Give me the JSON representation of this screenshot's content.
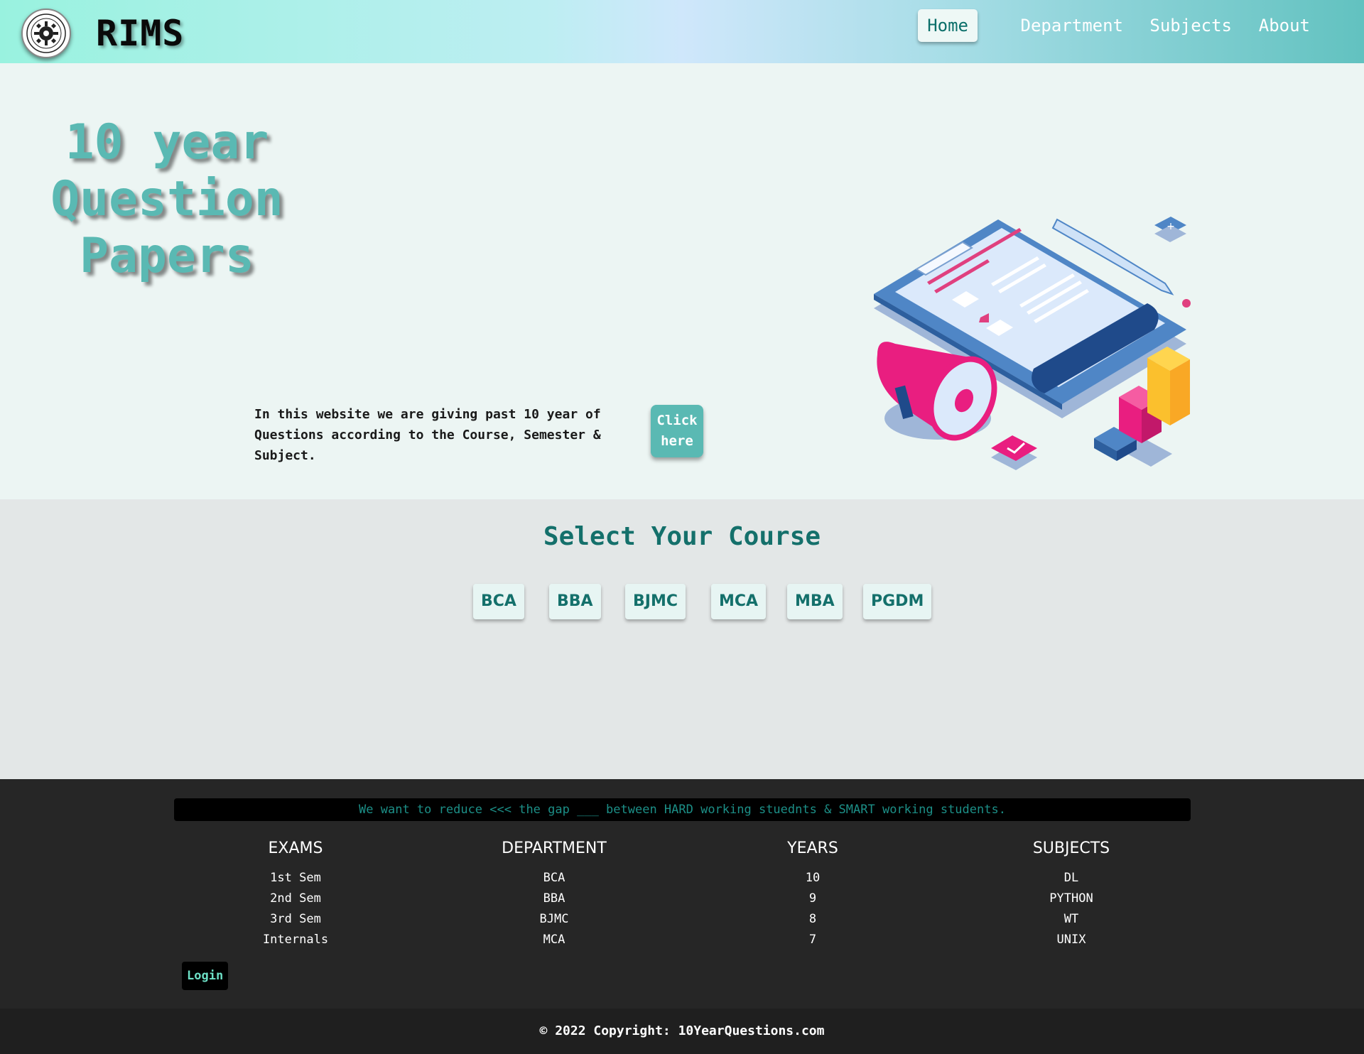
{
  "header": {
    "brand": "RIMS",
    "nav": [
      {
        "label": "Home",
        "active": true
      },
      {
        "label": "Department"
      },
      {
        "label": "Subjects"
      },
      {
        "label": "About"
      }
    ]
  },
  "hero": {
    "title_line1": "10 year",
    "title_line2": "Question",
    "title_line3": "Papers",
    "description": "In this website we are giving past 10 year of Questions according to the Course, Semester & Subject.",
    "button_line1": "Click",
    "button_line2": "here"
  },
  "course": {
    "title": "Select Your Course",
    "options": [
      "BCA",
      "BBA",
      "BJMC",
      "MCA",
      "MBA",
      "PGDM"
    ]
  },
  "footer": {
    "banner": "We want to reduce <<< the gap ___ between HARD working stuednts & SMART working students.",
    "columns": [
      {
        "heading": "EXAMS",
        "items": [
          "1st Sem",
          "2nd Sem",
          "3rd Sem",
          "Internals"
        ]
      },
      {
        "heading": "DEPARTMENT",
        "items": [
          "BCA",
          "BBA",
          "BJMC",
          "MCA"
        ]
      },
      {
        "heading": "YEARS",
        "items": [
          "10",
          "9",
          "8",
          "7"
        ]
      },
      {
        "heading": "SUBJECTS",
        "items": [
          "DL",
          "PYTHON",
          "WT",
          "UNIX"
        ]
      }
    ],
    "login": "Login",
    "copyright": "© 2022 Copyright: 10YearQuestions.com"
  },
  "colors": {
    "accent": "#5ab9b3",
    "dark_teal": "#14706b",
    "footer_bg": "#262626"
  }
}
